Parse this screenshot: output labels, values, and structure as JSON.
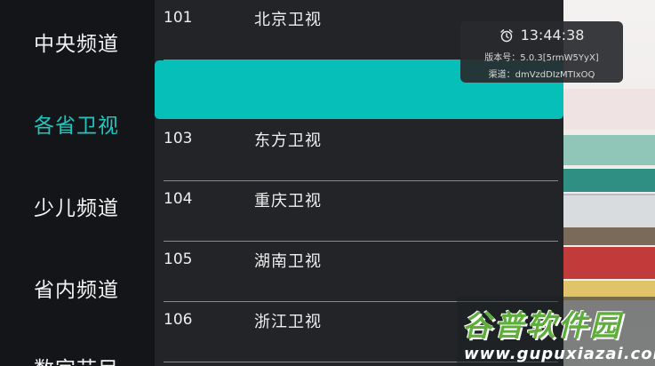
{
  "sidebar": {
    "items": [
      {
        "label": "中央频道"
      },
      {
        "label": "各省卫视"
      },
      {
        "label": "少儿频道"
      },
      {
        "label": "省内频道"
      },
      {
        "label": "数字节目"
      }
    ],
    "active_index": 1
  },
  "channels": [
    {
      "number": "101",
      "name": "北京卫视"
    },
    {
      "number": "",
      "name": ""
    },
    {
      "number": "103",
      "name": "东方卫视"
    },
    {
      "number": "104",
      "name": "重庆卫视"
    },
    {
      "number": "105",
      "name": "湖南卫视"
    },
    {
      "number": "106",
      "name": "浙江卫视"
    }
  ],
  "info": {
    "time": "13:44:38",
    "version": "版本号：5.0.3[5rmW5YyX]",
    "channel_code": "渠道：dmVzdDIzMTIxOQ"
  },
  "watermark": {
    "title": "谷普软件园",
    "url": "www.gupuxiazai.com"
  },
  "colors": {
    "accent": "#07bfb9",
    "active_text": "#1fc6be",
    "sidebar_bg": "#141519",
    "list_bg": "#232428"
  },
  "icons": {
    "clock": "alarm-clock-icon"
  }
}
